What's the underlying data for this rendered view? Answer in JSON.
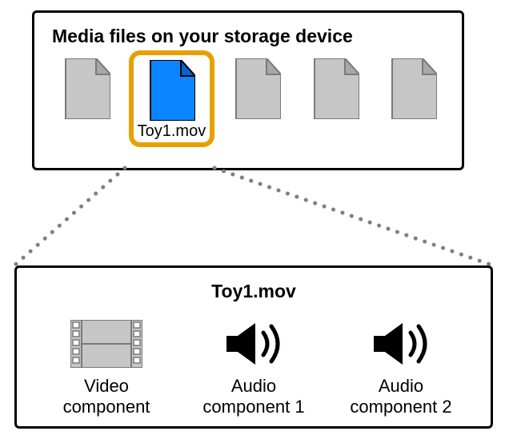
{
  "top": {
    "title": "Media files on your storage device",
    "selected_file_label": "Toy1.mov"
  },
  "bottom": {
    "title": "Toy1.mov",
    "components": {
      "video": "Video\ncomponent",
      "audio1": "Audio\ncomponent 1",
      "audio2": "Audio\ncomponent 2"
    }
  }
}
